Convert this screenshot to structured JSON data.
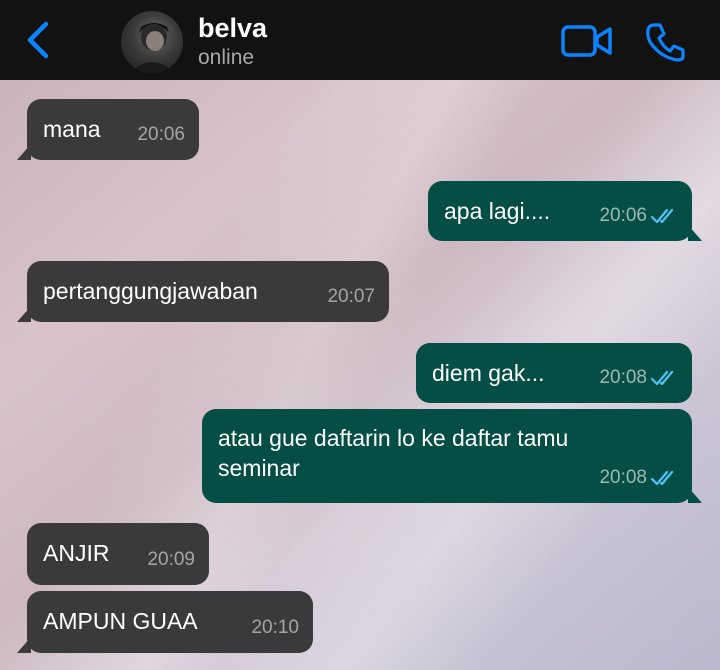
{
  "header": {
    "back_icon": "chevron-left-icon",
    "contact_name": "belva",
    "contact_status": "online",
    "video_icon": "video-camera-icon",
    "call_icon": "phone-icon",
    "accent_color": "#0a84ff"
  },
  "messages": [
    {
      "direction": "in",
      "text": "mana",
      "time": "20:06"
    },
    {
      "direction": "out",
      "text": "apa lagi....",
      "time": "20:06",
      "status": "read"
    },
    {
      "direction": "in",
      "text": "pertanggungjawaban",
      "time": "20:07"
    },
    {
      "direction": "out",
      "text": "diem gak...",
      "time": "20:08",
      "status": "read"
    },
    {
      "direction": "out",
      "text": "atau gue daftarin lo ke daftar tamu seminar",
      "time": "20:08",
      "status": "read"
    },
    {
      "direction": "in",
      "text": "ANJIR",
      "time": "20:09"
    },
    {
      "direction": "in",
      "text": "AMPUN GUAA",
      "time": "20:10"
    }
  ]
}
